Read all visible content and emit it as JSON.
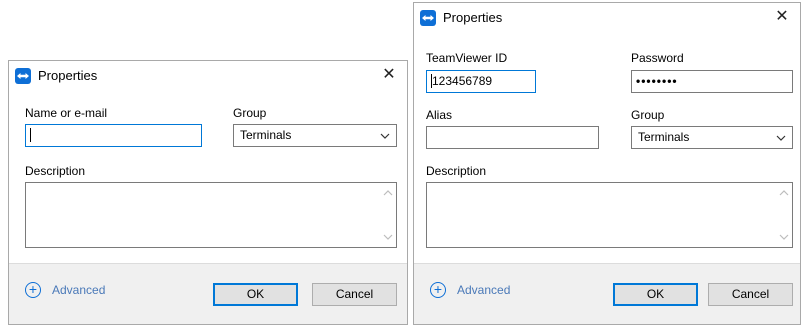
{
  "dialog_add": {
    "title": "Properties",
    "close_glyph": "✕",
    "name_label": "Name or e-mail",
    "name_value": "",
    "group_label": "Group",
    "group_value": "Terminals",
    "description_label": "Description",
    "description_value": "",
    "advanced_label": "Advanced",
    "ok_label": "OK",
    "cancel_label": "Cancel"
  },
  "dialog_edit": {
    "title": "Properties",
    "close_glyph": "✕",
    "id_label": "TeamViewer ID",
    "id_value": "123456789",
    "password_label": "Password",
    "password_value": "••••••••",
    "alias_label": "Alias",
    "alias_value": "",
    "group_label": "Group",
    "group_value": "Terminals",
    "description_label": "Description",
    "description_value": "",
    "advanced_label": "Advanced",
    "ok_label": "OK",
    "cancel_label": "Cancel"
  },
  "icons": {
    "app": "teamviewer-icon",
    "close": "close-icon",
    "dropdown": "chevron-down-icon",
    "advanced": "plus-circle-icon",
    "scroll_up": "scroll-up-icon",
    "scroll_down": "scroll-down-icon"
  },
  "colors": {
    "accent": "#0078d7",
    "brand": "#0e6fd6",
    "footer_bg": "#f0f0f0",
    "button_bg": "#e1e1e1"
  }
}
